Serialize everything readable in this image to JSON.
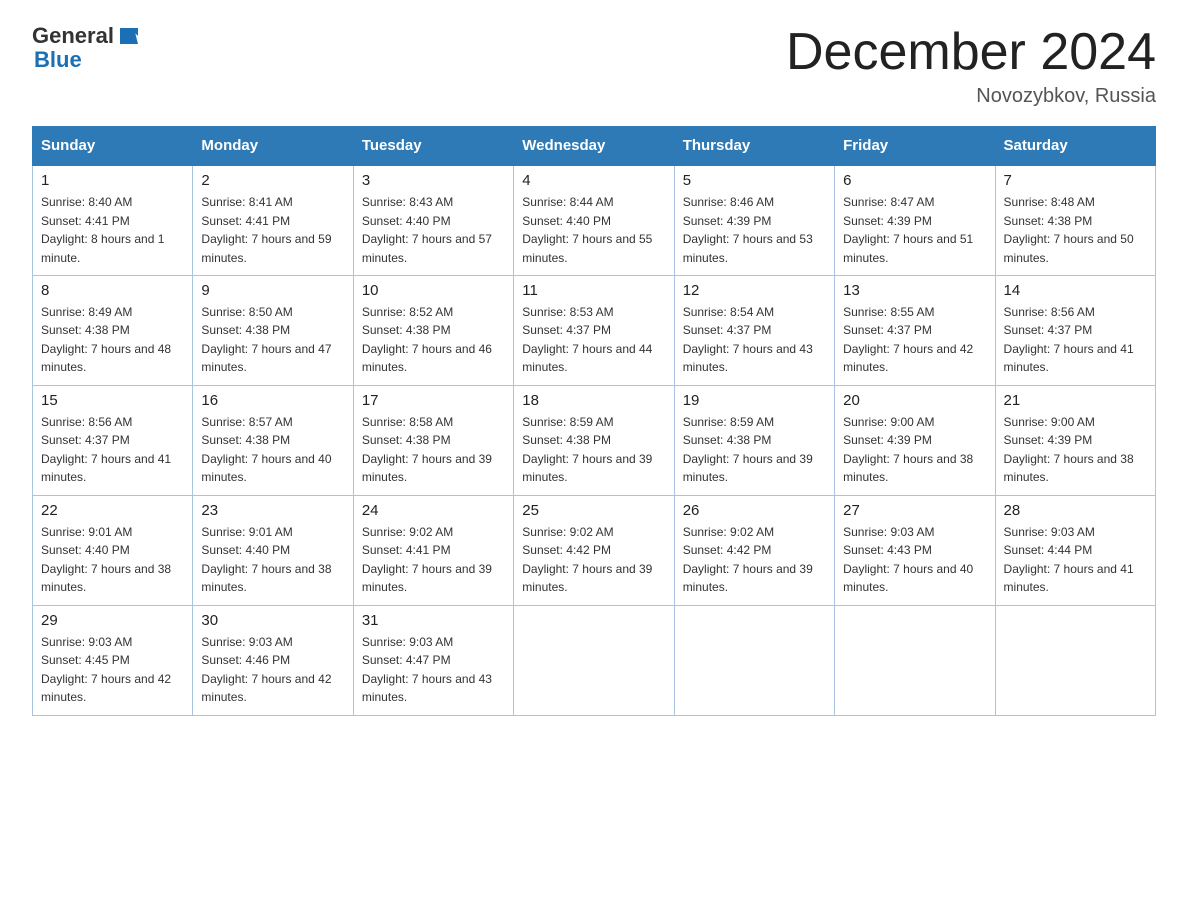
{
  "header": {
    "logo_general": "General",
    "logo_blue": "Blue",
    "month_title": "December 2024",
    "location": "Novozybkov, Russia"
  },
  "days_of_week": [
    "Sunday",
    "Monday",
    "Tuesday",
    "Wednesday",
    "Thursday",
    "Friday",
    "Saturday"
  ],
  "weeks": [
    [
      {
        "day": "1",
        "sunrise": "8:40 AM",
        "sunset": "4:41 PM",
        "daylight": "8 hours and 1 minute."
      },
      {
        "day": "2",
        "sunrise": "8:41 AM",
        "sunset": "4:41 PM",
        "daylight": "7 hours and 59 minutes."
      },
      {
        "day": "3",
        "sunrise": "8:43 AM",
        "sunset": "4:40 PM",
        "daylight": "7 hours and 57 minutes."
      },
      {
        "day": "4",
        "sunrise": "8:44 AM",
        "sunset": "4:40 PM",
        "daylight": "7 hours and 55 minutes."
      },
      {
        "day": "5",
        "sunrise": "8:46 AM",
        "sunset": "4:39 PM",
        "daylight": "7 hours and 53 minutes."
      },
      {
        "day": "6",
        "sunrise": "8:47 AM",
        "sunset": "4:39 PM",
        "daylight": "7 hours and 51 minutes."
      },
      {
        "day": "7",
        "sunrise": "8:48 AM",
        "sunset": "4:38 PM",
        "daylight": "7 hours and 50 minutes."
      }
    ],
    [
      {
        "day": "8",
        "sunrise": "8:49 AM",
        "sunset": "4:38 PM",
        "daylight": "7 hours and 48 minutes."
      },
      {
        "day": "9",
        "sunrise": "8:50 AM",
        "sunset": "4:38 PM",
        "daylight": "7 hours and 47 minutes."
      },
      {
        "day": "10",
        "sunrise": "8:52 AM",
        "sunset": "4:38 PM",
        "daylight": "7 hours and 46 minutes."
      },
      {
        "day": "11",
        "sunrise": "8:53 AM",
        "sunset": "4:37 PM",
        "daylight": "7 hours and 44 minutes."
      },
      {
        "day": "12",
        "sunrise": "8:54 AM",
        "sunset": "4:37 PM",
        "daylight": "7 hours and 43 minutes."
      },
      {
        "day": "13",
        "sunrise": "8:55 AM",
        "sunset": "4:37 PM",
        "daylight": "7 hours and 42 minutes."
      },
      {
        "day": "14",
        "sunrise": "8:56 AM",
        "sunset": "4:37 PM",
        "daylight": "7 hours and 41 minutes."
      }
    ],
    [
      {
        "day": "15",
        "sunrise": "8:56 AM",
        "sunset": "4:37 PM",
        "daylight": "7 hours and 41 minutes."
      },
      {
        "day": "16",
        "sunrise": "8:57 AM",
        "sunset": "4:38 PM",
        "daylight": "7 hours and 40 minutes."
      },
      {
        "day": "17",
        "sunrise": "8:58 AM",
        "sunset": "4:38 PM",
        "daylight": "7 hours and 39 minutes."
      },
      {
        "day": "18",
        "sunrise": "8:59 AM",
        "sunset": "4:38 PM",
        "daylight": "7 hours and 39 minutes."
      },
      {
        "day": "19",
        "sunrise": "8:59 AM",
        "sunset": "4:38 PM",
        "daylight": "7 hours and 39 minutes."
      },
      {
        "day": "20",
        "sunrise": "9:00 AM",
        "sunset": "4:39 PM",
        "daylight": "7 hours and 38 minutes."
      },
      {
        "day": "21",
        "sunrise": "9:00 AM",
        "sunset": "4:39 PM",
        "daylight": "7 hours and 38 minutes."
      }
    ],
    [
      {
        "day": "22",
        "sunrise": "9:01 AM",
        "sunset": "4:40 PM",
        "daylight": "7 hours and 38 minutes."
      },
      {
        "day": "23",
        "sunrise": "9:01 AM",
        "sunset": "4:40 PM",
        "daylight": "7 hours and 38 minutes."
      },
      {
        "day": "24",
        "sunrise": "9:02 AM",
        "sunset": "4:41 PM",
        "daylight": "7 hours and 39 minutes."
      },
      {
        "day": "25",
        "sunrise": "9:02 AM",
        "sunset": "4:42 PM",
        "daylight": "7 hours and 39 minutes."
      },
      {
        "day": "26",
        "sunrise": "9:02 AM",
        "sunset": "4:42 PM",
        "daylight": "7 hours and 39 minutes."
      },
      {
        "day": "27",
        "sunrise": "9:03 AM",
        "sunset": "4:43 PM",
        "daylight": "7 hours and 40 minutes."
      },
      {
        "day": "28",
        "sunrise": "9:03 AM",
        "sunset": "4:44 PM",
        "daylight": "7 hours and 41 minutes."
      }
    ],
    [
      {
        "day": "29",
        "sunrise": "9:03 AM",
        "sunset": "4:45 PM",
        "daylight": "7 hours and 42 minutes."
      },
      {
        "day": "30",
        "sunrise": "9:03 AM",
        "sunset": "4:46 PM",
        "daylight": "7 hours and 42 minutes."
      },
      {
        "day": "31",
        "sunrise": "9:03 AM",
        "sunset": "4:47 PM",
        "daylight": "7 hours and 43 minutes."
      },
      null,
      null,
      null,
      null
    ]
  ]
}
